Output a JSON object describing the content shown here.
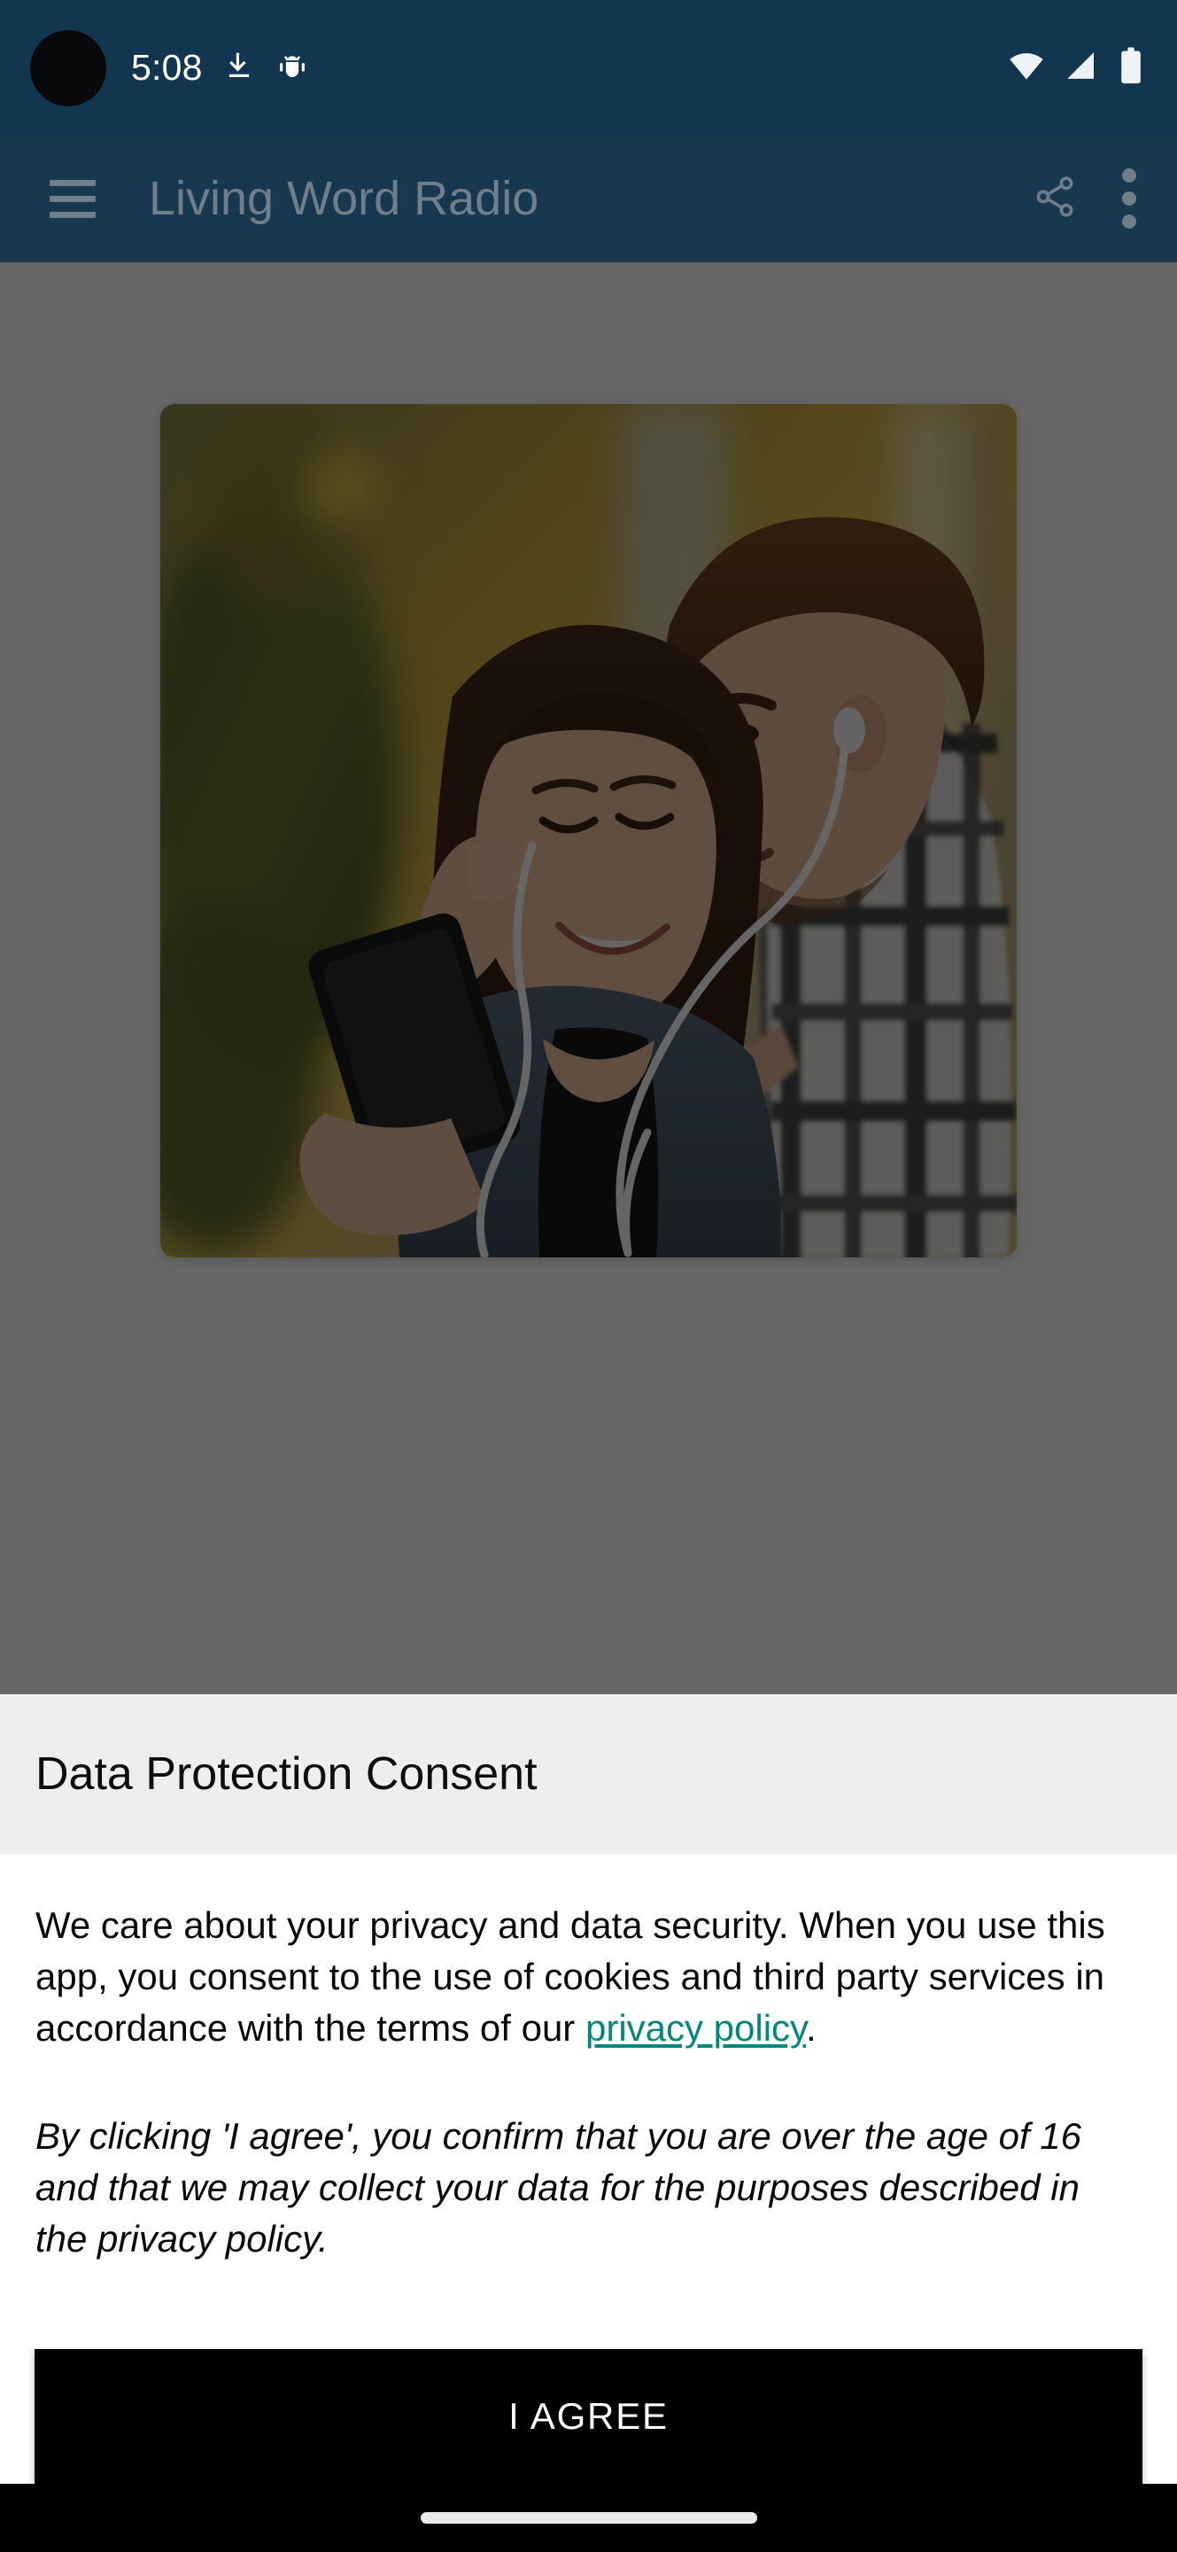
{
  "status_bar": {
    "time": "5:08",
    "icons_left": [
      "download-icon",
      "android-bug-icon"
    ],
    "icons_right": [
      "wifi-icon",
      "cellular-signal-icon",
      "battery-icon"
    ],
    "background_color": "#123650"
  },
  "app_bar": {
    "menu_icon": "hamburger-menu-icon",
    "title": "Living Word Radio",
    "share_icon": "share-icon",
    "overflow_icon": "more-vertical-icon",
    "background_color": "#17384f",
    "title_color": "#6f7e88"
  },
  "content": {
    "hero_image_alt": "Couple listening to music on a phone with shared earphones",
    "scrim_color": "#666666"
  },
  "dialog": {
    "title": "Data Protection Consent",
    "paragraph_1_before_link": "We care about your privacy and data security. When you use this app, you consent to the use of cookies and third party services in accordance with the terms of our ",
    "link_text": "privacy policy",
    "paragraph_1_after_link": ".",
    "paragraph_2": "By clicking 'I agree', you confirm that you are over the age of 16 and that we may collect your data for the purposes described in the privacy policy.",
    "agree_button_label": "I AGREE",
    "header_background": "#eeeeee",
    "link_color": "#00897b",
    "button_background": "#000000"
  },
  "nav_bar": {
    "gesture_pill": "home-gesture-pill",
    "background_color": "#000000"
  }
}
